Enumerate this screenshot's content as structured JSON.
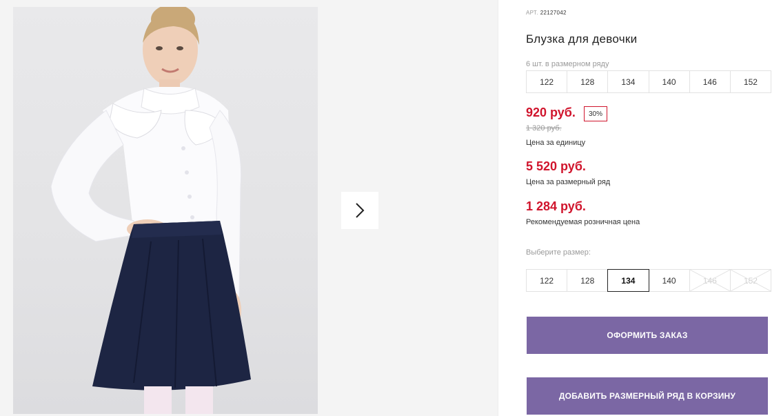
{
  "product": {
    "art_label": "АРТ.",
    "art_value": "22127042",
    "title": "Блузка для девочки"
  },
  "size_grid": {
    "label": "6 шт. в размерном ряду",
    "sizes": [
      "122",
      "128",
      "134",
      "140",
      "146",
      "152"
    ]
  },
  "pricing": {
    "unit_price": "920 руб.",
    "discount_badge": "30%",
    "old_price": "1 320 руб.",
    "unit_caption": "Цена за единицу",
    "row_price": "5 520 руб.",
    "row_caption": "Цена за размерный ряд",
    "retail_price": "1 284 руб.",
    "retail_caption": "Рекомендуемая розничная цена",
    "price_color": "#d0142c"
  },
  "size_select": {
    "label": "Выберите размер:",
    "options": [
      {
        "size": "122",
        "state": "available"
      },
      {
        "size": "128",
        "state": "available"
      },
      {
        "size": "134",
        "state": "selected"
      },
      {
        "size": "140",
        "state": "available"
      },
      {
        "size": "146",
        "state": "unavailable"
      },
      {
        "size": "152",
        "state": "unavailable"
      }
    ]
  },
  "actions": {
    "order_label": "ОФОРМИТЬ ЗАКАЗ",
    "add_row_label": "ДОБАВИТЬ РАЗМЕРНЫЙ РЯД В КОРЗИНУ",
    "button_color": "#7b67a4"
  },
  "gallery": {
    "next_icon": "chevron-right-icon"
  }
}
